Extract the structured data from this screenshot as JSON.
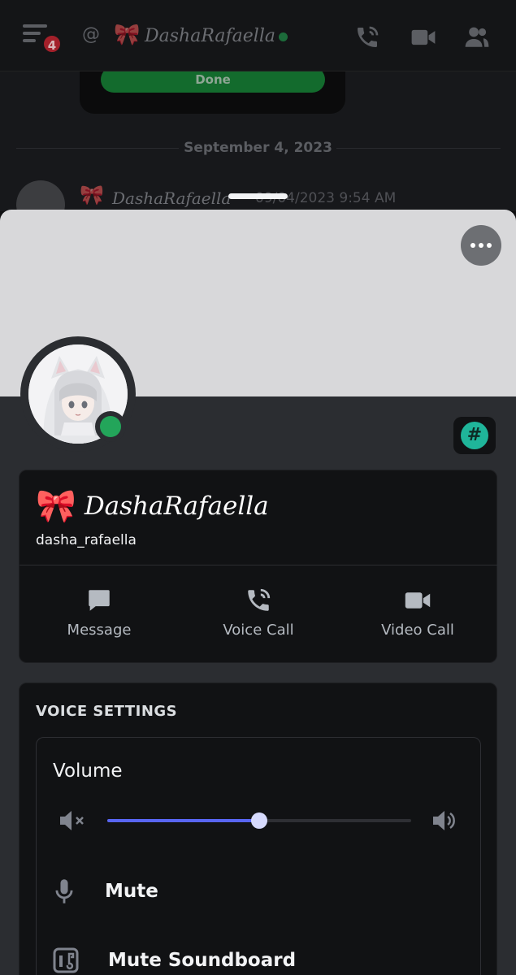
{
  "topbar": {
    "notification_count": "4",
    "dm_name": "DashaRafaella",
    "bow_emoji": "🎀"
  },
  "background_chat": {
    "done_label": "Done",
    "date_separator": "September 4, 2023",
    "message_author": "DashaRafaella",
    "message_time": "09/04/2023 9:54 AM"
  },
  "profile": {
    "bow_emoji": "🎀",
    "display_name": "DashaRafaella",
    "username": "dasha_rafaella",
    "status": "online",
    "badge_symbol": "#"
  },
  "actions": {
    "message": "Message",
    "voice_call": "Voice Call",
    "video_call": "Video Call"
  },
  "voice_settings": {
    "title": "VOICE SETTINGS",
    "volume_label": "Volume",
    "volume_fraction": 0.5,
    "mute_label": "Mute",
    "mute_soundboard_label": "Mute Soundboard"
  },
  "colors": {
    "accent": "#5865f2",
    "online": "#23a55a",
    "sheet_bg": "#2b2d31",
    "card_bg": "#111214"
  }
}
